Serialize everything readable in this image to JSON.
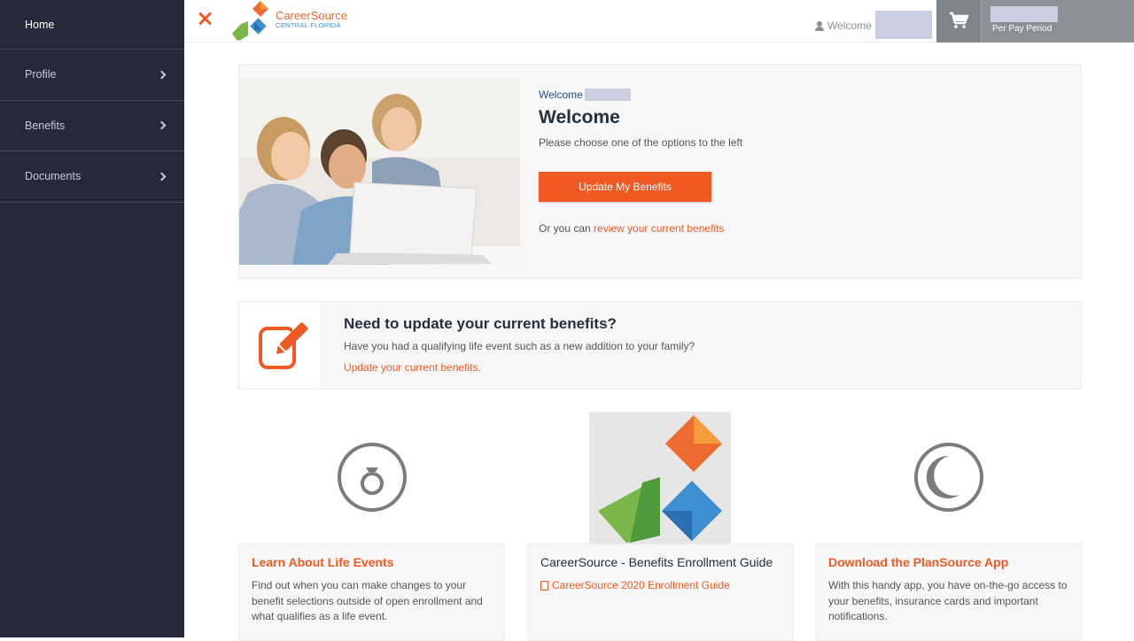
{
  "sidebar": {
    "items": [
      {
        "label": "Home"
      },
      {
        "label": "Profile"
      },
      {
        "label": "Benefits"
      },
      {
        "label": "Documents"
      }
    ]
  },
  "header": {
    "logo_line1": "CareerSource",
    "logo_line2": "CENTRAL FLORIDA",
    "welcome": "Welcome",
    "per_pay_period": "Per Pay Period"
  },
  "welcome_panel": {
    "small_welcome": "Welcome",
    "title": "Welcome",
    "subtitle": "Please choose one of the options to the left",
    "button": "Update My Benefits",
    "or_text": "Or you can ",
    "review_link": "review your current benefits"
  },
  "update_panel": {
    "title": "Need to update your current benefits?",
    "subtitle": "Have you had a qualifying life event such as a new addition to your family?",
    "link": "Update your current benefits."
  },
  "cards": [
    {
      "title": "Learn About Life Events",
      "text": "Find out when you can make changes to your benefit selections outside of open enrollment and what qualifies as a life event."
    },
    {
      "title": "CareerSource - Benefits Enrollment Guide",
      "link": "CareerSource 2020 Enrollment Guide"
    },
    {
      "title": "Download the PlanSource App",
      "text": "With this handy app, you have on-the-go access to your benefits, insurance cards and important notifications."
    }
  ],
  "colors": {
    "accent": "#ee5a24",
    "sidebar": "#232b3a",
    "logo_orange": "#ee6b2f",
    "logo_blue": "#3d8fd1",
    "logo_green": "#7ab648"
  }
}
